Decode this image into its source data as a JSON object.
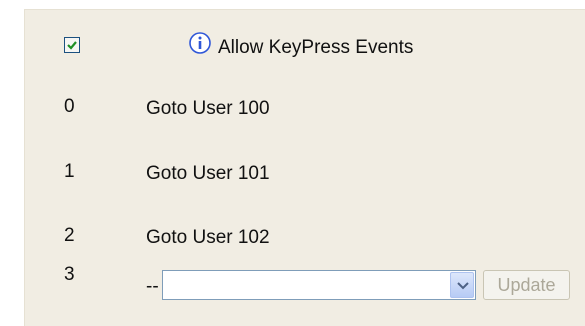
{
  "header": {
    "allow_keypress_checked": true,
    "allow_keypress_label": "Allow KeyPress Events",
    "info_icon": "info-icon"
  },
  "rows": [
    {
      "index": "0",
      "label": "Goto User 100"
    },
    {
      "index": "1",
      "label": "Goto User 101"
    },
    {
      "index": "2",
      "label": "Goto User 102"
    }
  ],
  "new_row": {
    "index": "3",
    "prefix": "--",
    "select_value": "",
    "update_label": "Update",
    "update_enabled": false
  },
  "colors": {
    "panel_background": "#f1ede3",
    "checkmark": "#1f8f24",
    "info_icon": "#2f57d8",
    "disabled_text": "#aca899"
  }
}
